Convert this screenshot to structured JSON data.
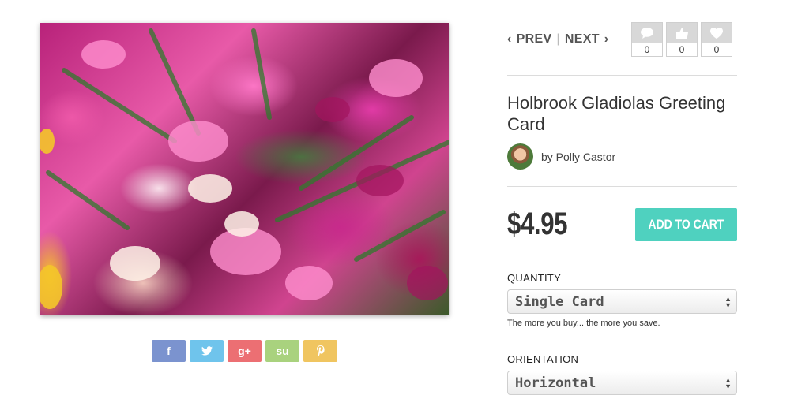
{
  "navigation": {
    "prev_label": "PREV",
    "separator": "|",
    "next_label": "NEXT"
  },
  "stats": [
    {
      "icon": "comment-icon",
      "count": "0"
    },
    {
      "icon": "thumbs-up-icon",
      "count": "0"
    },
    {
      "icon": "heart-icon",
      "count": "0"
    }
  ],
  "product": {
    "title": "Holbrook Gladiolas Greeting Card",
    "byline": "by Polly Castor",
    "price": "$4.95",
    "add_to_cart_label": "ADD TO CART"
  },
  "quantity": {
    "label": "QUANTITY",
    "selected": "Single Card",
    "hint": "The more you buy... the more you save."
  },
  "orientation": {
    "label": "ORIENTATION",
    "selected": "Horizontal"
  },
  "share": {
    "facebook": "f",
    "twitter": "twitter-icon",
    "googleplus": "g+",
    "stumbleupon": "su",
    "pinterest": "pinterest-icon"
  },
  "colors": {
    "accent": "#4fd1bf",
    "facebook": "#7b93cf",
    "twitter": "#6fc4ec",
    "googleplus": "#ec6f73",
    "stumbleupon": "#a9d27e",
    "pinterest": "#f0c560"
  }
}
